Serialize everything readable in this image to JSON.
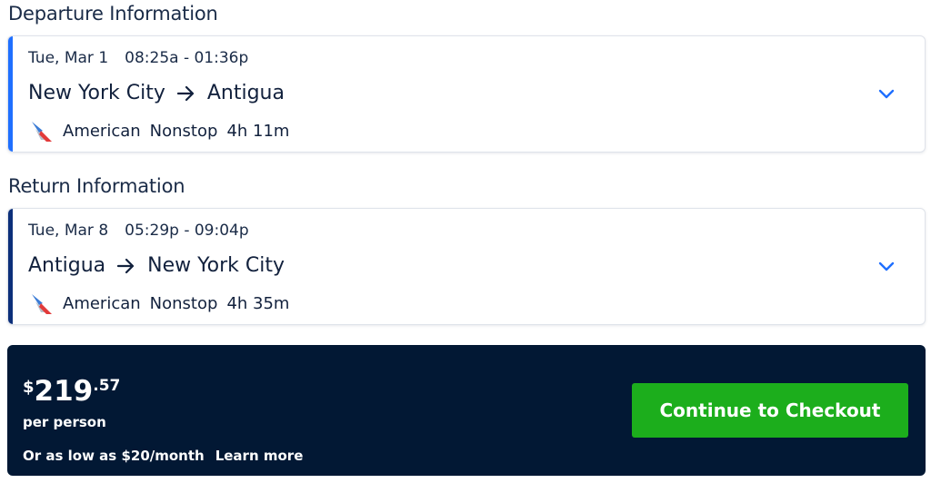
{
  "departure": {
    "section_title": "Departure Information",
    "date": "Tue, Mar 1",
    "time": "08:25a - 01:36p",
    "origin": "New York City",
    "destination": "Antigua",
    "airline": "American",
    "stops": "Nonstop",
    "duration": "4h 11m",
    "accent_color": "#1f6fff"
  },
  "return": {
    "section_title": "Return Information",
    "date": "Tue, Mar 8",
    "time": "05:29p - 09:04p",
    "origin": "Antigua",
    "destination": "New York City",
    "airline": "American",
    "stops": "Nonstop",
    "duration": "4h 35m",
    "accent_color": "#0c2f7a"
  },
  "summary": {
    "currency_symbol": "$",
    "price_dollars": "219",
    "price_cents": ".57",
    "per_person": "per person",
    "financing_text": "Or as low as $20/month",
    "learn_more": "Learn more",
    "checkout_label": "Continue to Checkout"
  },
  "icons": {
    "route_arrow": "arrow-right-icon",
    "expand": "chevron-down-icon",
    "airline_logo": "american-airlines-logo"
  },
  "colors": {
    "bar_background": "#021834",
    "checkout_button": "#1cae1c",
    "chevron": "#1f6fff"
  }
}
